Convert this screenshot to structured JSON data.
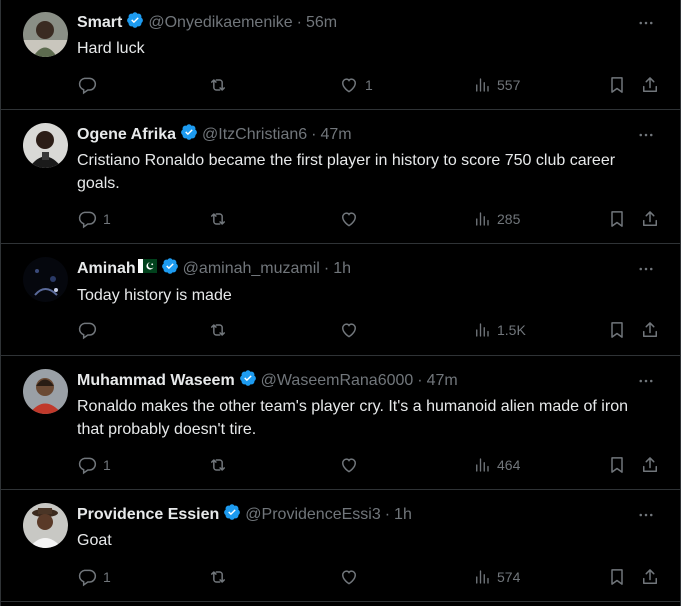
{
  "tweets": [
    {
      "name": "Smart",
      "flag": false,
      "handle": "@Onyedikaemenike",
      "dot": "·",
      "time": "56m",
      "text": "Hard luck",
      "reply_count": "",
      "retweet_count": "",
      "like_count": "1",
      "view_count": "557"
    },
    {
      "name": "Ogene Afrika",
      "flag": false,
      "handle": "@ItzChristian6",
      "dot": "·",
      "time": "47m",
      "text": "Cristiano Ronaldo became the first player in history to score 750 club career goals.",
      "reply_count": "1",
      "retweet_count": "",
      "like_count": "",
      "view_count": "285"
    },
    {
      "name": "Aminah",
      "flag": true,
      "handle": "@aminah_muzamil",
      "dot": "·",
      "time": "1h",
      "text": "Today history is made",
      "reply_count": "",
      "retweet_count": "",
      "like_count": "",
      "view_count": "1.5K"
    },
    {
      "name": "Muhammad Waseem",
      "flag": false,
      "handle": "@WaseemRana6000",
      "dot": "·",
      "time": "47m",
      "text": "Ronaldo makes the other team's player cry.  It's a humanoid alien made of iron that probably doesn't tire.",
      "reply_count": "1",
      "retweet_count": "",
      "like_count": "",
      "view_count": "464"
    },
    {
      "name": "Providence Essien",
      "flag": false,
      "handle": "@ProvidenceEssi3",
      "dot": "·",
      "time": "1h",
      "text": "Goat",
      "reply_count": "1",
      "retweet_count": "",
      "like_count": "",
      "view_count": "574"
    }
  ],
  "icons": {
    "verified": "verified-badge-icon",
    "more": "more-options-icon",
    "reply": "reply-icon",
    "retweet": "retweet-icon",
    "like": "like-heart-icon",
    "views": "views-chart-icon",
    "bookmark": "bookmark-icon",
    "share": "share-icon"
  },
  "colors": {
    "background": "#000000",
    "text": "#e7e9ea",
    "secondary": "#71767b",
    "divider": "#2f3336",
    "verified": "#1d9bf0"
  }
}
